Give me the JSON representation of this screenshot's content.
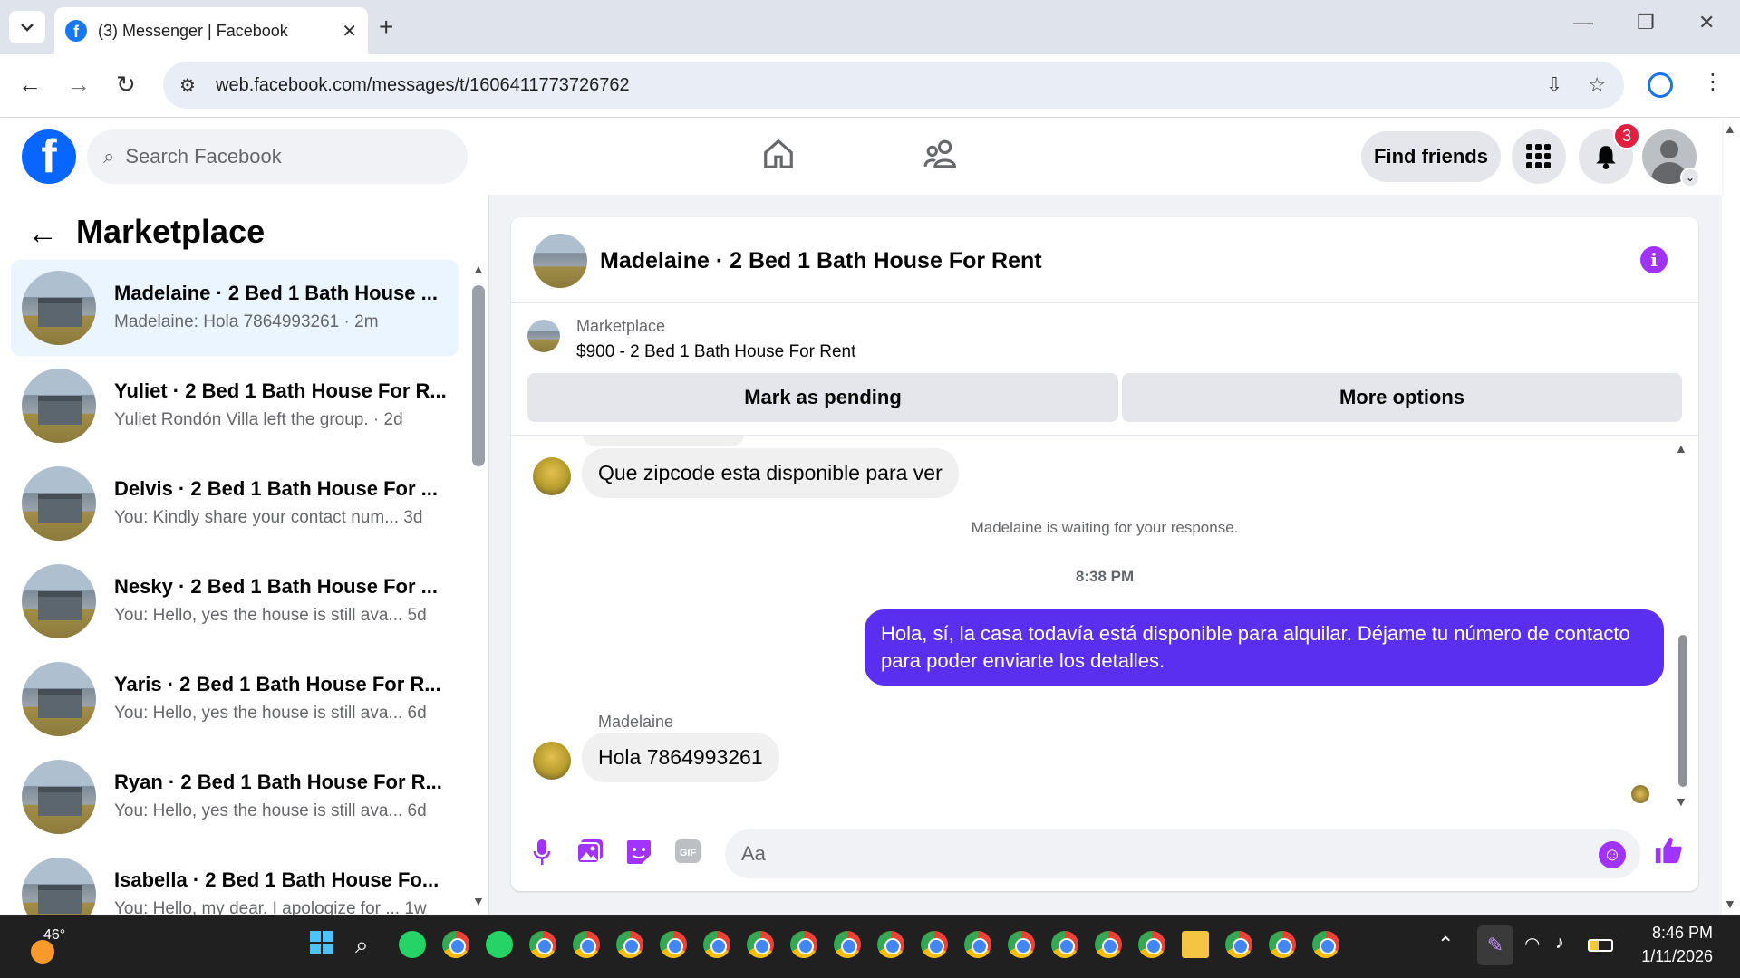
{
  "browser": {
    "tab_title": "(3) Messenger | Facebook",
    "url": "web.facebook.com/messages/t/1606411773726762"
  },
  "header": {
    "search_placeholder": "Search Facebook",
    "find_friends": "Find friends",
    "notification_count": "3"
  },
  "sidebar": {
    "title": "Marketplace",
    "conversations": [
      {
        "name": "Madelaine · 2 Bed 1 Bath House ...",
        "snippet": "Madelaine: Hola 7864993261 · 2m",
        "active": true
      },
      {
        "name": "Yuliet · 2 Bed 1 Bath House For R...",
        "snippet": "Yuliet Rondón Villa left the group. · 2d"
      },
      {
        "name": "Delvis · 2 Bed 1 Bath House For ...",
        "snippet": "You: Kindly share your contact num...  3d"
      },
      {
        "name": "Nesky · 2 Bed 1 Bath House For ...",
        "snippet": "You: Hello, yes the house is still ava...  5d"
      },
      {
        "name": "Yaris · 2 Bed 1 Bath House For R...",
        "snippet": "You: Hello, yes the house is still ava...  6d"
      },
      {
        "name": "Ryan · 2 Bed 1 Bath House For R...",
        "snippet": "You: Hello, yes the house is still ava...  6d"
      },
      {
        "name": "Isabella · 2 Bed 1 Bath House Fo...",
        "snippet": "You: Hello, my dear. I apologize for ...  1w"
      }
    ]
  },
  "chat": {
    "title": "Madelaine · 2 Bed 1 Bath House For Rent",
    "marketplace_label": "Marketplace",
    "listing": "$900 - 2 Bed 1 Bath House For Rent",
    "mark_pending": "Mark as pending",
    "more_options": "More options",
    "msg1": "Que zipcode esta disponible para ver",
    "waiting": "Madelaine is waiting for your response.",
    "time": "8:38 PM",
    "msg_out": "Hola, sí, la casa todavía está disponible para alquilar. Déjame tu número de contacto para poder enviarte los detalles.",
    "sender": "Madelaine",
    "msg2": "Hola 7864993261",
    "composer_placeholder": "Aa"
  },
  "taskbar": {
    "temp": "46°",
    "clock_time": "8:46 PM",
    "clock_date": "1/11/2026"
  }
}
